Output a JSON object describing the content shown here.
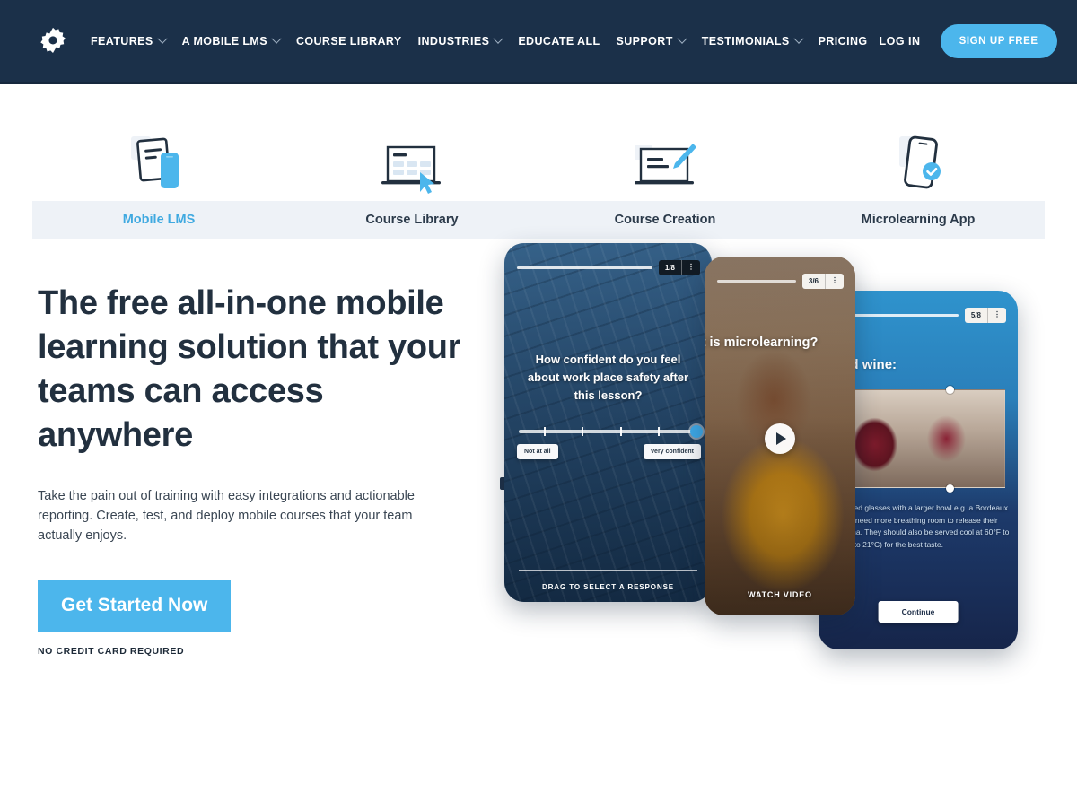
{
  "colors": {
    "nav_bg": "#1b3049",
    "accent": "#4cb6ec",
    "tab_active": "#3fa9e0",
    "tab_strip_bg": "#eef2f7",
    "heading": "#22303f",
    "dot_active": "#1e3148",
    "dot_inactive": "#ccd8e4"
  },
  "nav": {
    "logo_icon": "gear-icon",
    "items": [
      {
        "label": "FEATURES",
        "has_dropdown": true
      },
      {
        "label": "A MOBILE LMS",
        "has_dropdown": true
      },
      {
        "label": "COURSE LIBRARY",
        "has_dropdown": false
      },
      {
        "label": "INDUSTRIES",
        "has_dropdown": true
      },
      {
        "label": "EDUCATE ALL",
        "has_dropdown": false
      },
      {
        "label": "SUPPORT",
        "has_dropdown": true
      },
      {
        "label": "TESTIMONIALS",
        "has_dropdown": true
      },
      {
        "label": "PRICING",
        "has_dropdown": false
      }
    ],
    "login_label": "LOG IN",
    "signup_label": "SIGN UP FREE"
  },
  "tabs": [
    {
      "label": "Mobile LMS",
      "icon": "document-and-phone-icon",
      "active": true
    },
    {
      "label": "Course Library",
      "icon": "laptop-grid-cursor-icon",
      "active": false
    },
    {
      "label": "Course Creation",
      "icon": "laptop-pen-icon",
      "active": false
    },
    {
      "label": "Microlearning App",
      "icon": "phone-check-icon",
      "active": false
    }
  ],
  "hero": {
    "title": "The free all-in-one mobile learning solution that your teams can access anywhere",
    "subtitle": "Take the pain out of training with easy integrations and actionable reporting. Create, test, and deploy mobile courses that your team actually enjoys.",
    "cta_label": "Get Started Now",
    "cta_note": "NO CREDIT CARD REQUIRED"
  },
  "phones": {
    "phone1": {
      "badge_count": "1/8",
      "badge_menu_icon": "kebab-menu-icon",
      "question": "How confident do you feel about work place safety after this lesson?",
      "scale_min_label": "Not at all",
      "scale_max_label": "Very confident",
      "footer": "DRAG TO SELECT A RESPONSE"
    },
    "phone2": {
      "badge_count": "3/6",
      "badge_menu_icon": "kebab-menu-icon",
      "title": "What is microlearning?",
      "play_icon": "play-icon",
      "footer": "WATCH VIDEO"
    },
    "phone3": {
      "badge_count": "5/8",
      "badge_menu_icon": "kebab-menu-icon",
      "title": "Serving red wine:",
      "body": "Red wines need glasses with a larger bowl e.g. a Bordeaux because they need more breathing room to release their powerful aroma. They should also be served cool at 60°F to 70°F (15.5°C to 21°C) for the best taste.",
      "continue_label": "Continue"
    }
  },
  "carousel": {
    "dots": [
      {
        "active": true
      },
      {
        "active": false
      },
      {
        "active": false
      },
      {
        "active": false
      }
    ]
  }
}
